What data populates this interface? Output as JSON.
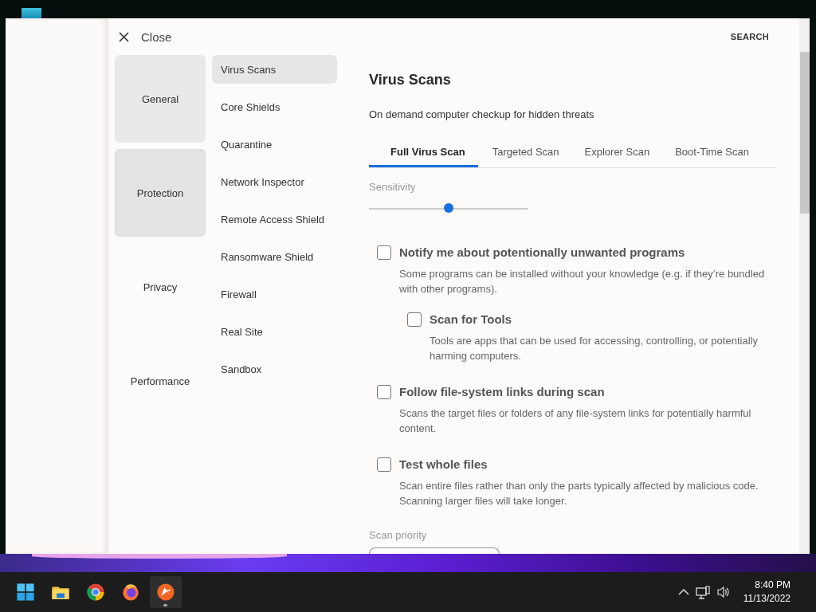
{
  "header": {
    "close_label": "Close",
    "search_label": "SEARCH"
  },
  "categories": [
    {
      "label": "General",
      "selected": false,
      "hovered": true
    },
    {
      "label": "Protection",
      "selected": true,
      "hovered": false
    },
    {
      "label": "Privacy",
      "selected": false,
      "hovered": false
    },
    {
      "label": "Performance",
      "selected": false,
      "hovered": false
    }
  ],
  "submenu": [
    {
      "label": "Virus Scans",
      "selected": true
    },
    {
      "label": "Core Shields",
      "selected": false
    },
    {
      "label": "Quarantine",
      "selected": false
    },
    {
      "label": "Network Inspector",
      "selected": false
    },
    {
      "label": "Remote Access Shield",
      "selected": false
    },
    {
      "label": "Ransomware Shield",
      "selected": false
    },
    {
      "label": "Firewall",
      "selected": false
    },
    {
      "label": "Real Site",
      "selected": false
    },
    {
      "label": "Sandbox",
      "selected": false
    }
  ],
  "content": {
    "title": "Virus Scans",
    "subtitle": "On demand computer checkup for hidden threats",
    "tabs": [
      {
        "label": "Full Virus Scan",
        "selected": true
      },
      {
        "label": "Targeted Scan",
        "selected": false
      },
      {
        "label": "Explorer Scan",
        "selected": false
      },
      {
        "label": "Boot-Time Scan",
        "selected": false
      }
    ],
    "sensitivity": {
      "label": "Sensitivity",
      "level": 0.5
    },
    "options": [
      {
        "label": "Notify me about potentionally unwanted programs",
        "description": "Some programs can be installed without your knowledge (e.g. if they’re bundled with other programs).",
        "checked": false,
        "children": [
          {
            "label": "Scan for Tools",
            "description": "Tools are apps that can be used for accessing, controlling, or potentially harming computers.",
            "checked": false
          }
        ]
      },
      {
        "label": "Follow file-system links during scan",
        "description": "Scans the target files or folders of any file-system links for potentially harmful content.",
        "checked": false
      },
      {
        "label": "Test whole files",
        "description": "Scan entire files rather than only the parts typically affected by malicious code. Scanning larger files will take longer.",
        "checked": false
      }
    ],
    "scan_priority": {
      "label": "Scan priority"
    }
  },
  "taskbar": {
    "apps": [
      {
        "kind": "start",
        "active": false
      },
      {
        "kind": "explorer",
        "active": false
      },
      {
        "kind": "chrome",
        "active": false
      },
      {
        "kind": "firefox",
        "active": false
      },
      {
        "kind": "avast",
        "active": true
      }
    ],
    "time": "8:40 PM",
    "date": "11/13/2022"
  }
}
